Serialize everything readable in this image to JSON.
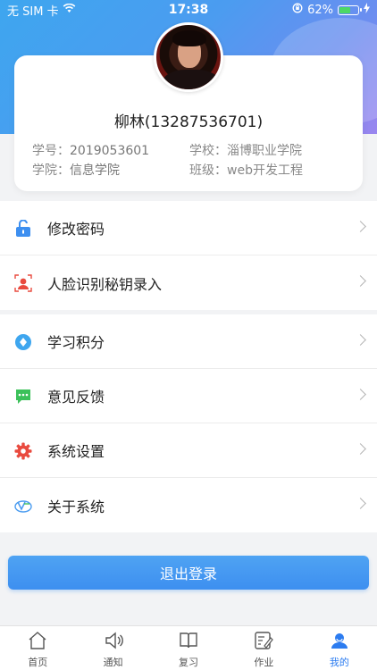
{
  "status_bar": {
    "carrier": "无 SIM 卡",
    "time": "17:38",
    "battery_percent": "62%",
    "battery_level": 0.62
  },
  "profile": {
    "name": "柳林(13287536701)",
    "student_id_label": "学号：",
    "student_id": "2019053601",
    "school_label": "学校：",
    "school": "淄博职业学院",
    "college_label": "学院：",
    "college": "信息学院",
    "class_label": "班级：",
    "class": "web开发工程"
  },
  "menu_group_1": [
    {
      "label": "修改密码",
      "icon": "unlock-icon",
      "color": "#3d8ff0"
    },
    {
      "label": "人脸识别秘钥录入",
      "icon": "face-id-icon",
      "color": "#e94a3e"
    }
  ],
  "menu_group_2": [
    {
      "label": "学习积分",
      "icon": "points-icon",
      "color": "#3ea6ef"
    },
    {
      "label": "意见反馈",
      "icon": "feedback-icon",
      "color": "#3cc15a"
    },
    {
      "label": "系统设置",
      "icon": "gear-icon",
      "color": "#e94a3e"
    },
    {
      "label": "关于系统",
      "icon": "about-logo-icon",
      "color": "#4b9cf0"
    }
  ],
  "logout_label": "退出登录",
  "tabs": [
    {
      "label": "首页",
      "icon": "home-icon",
      "active": false
    },
    {
      "label": "通知",
      "icon": "speaker-icon",
      "active": false
    },
    {
      "label": "复习",
      "icon": "book-icon",
      "active": false
    },
    {
      "label": "作业",
      "icon": "edit-icon",
      "active": false
    },
    {
      "label": "我的",
      "icon": "user-icon",
      "active": true
    }
  ],
  "colors": {
    "accent": "#3d8ff0",
    "active_tab": "#2c7cf0"
  }
}
